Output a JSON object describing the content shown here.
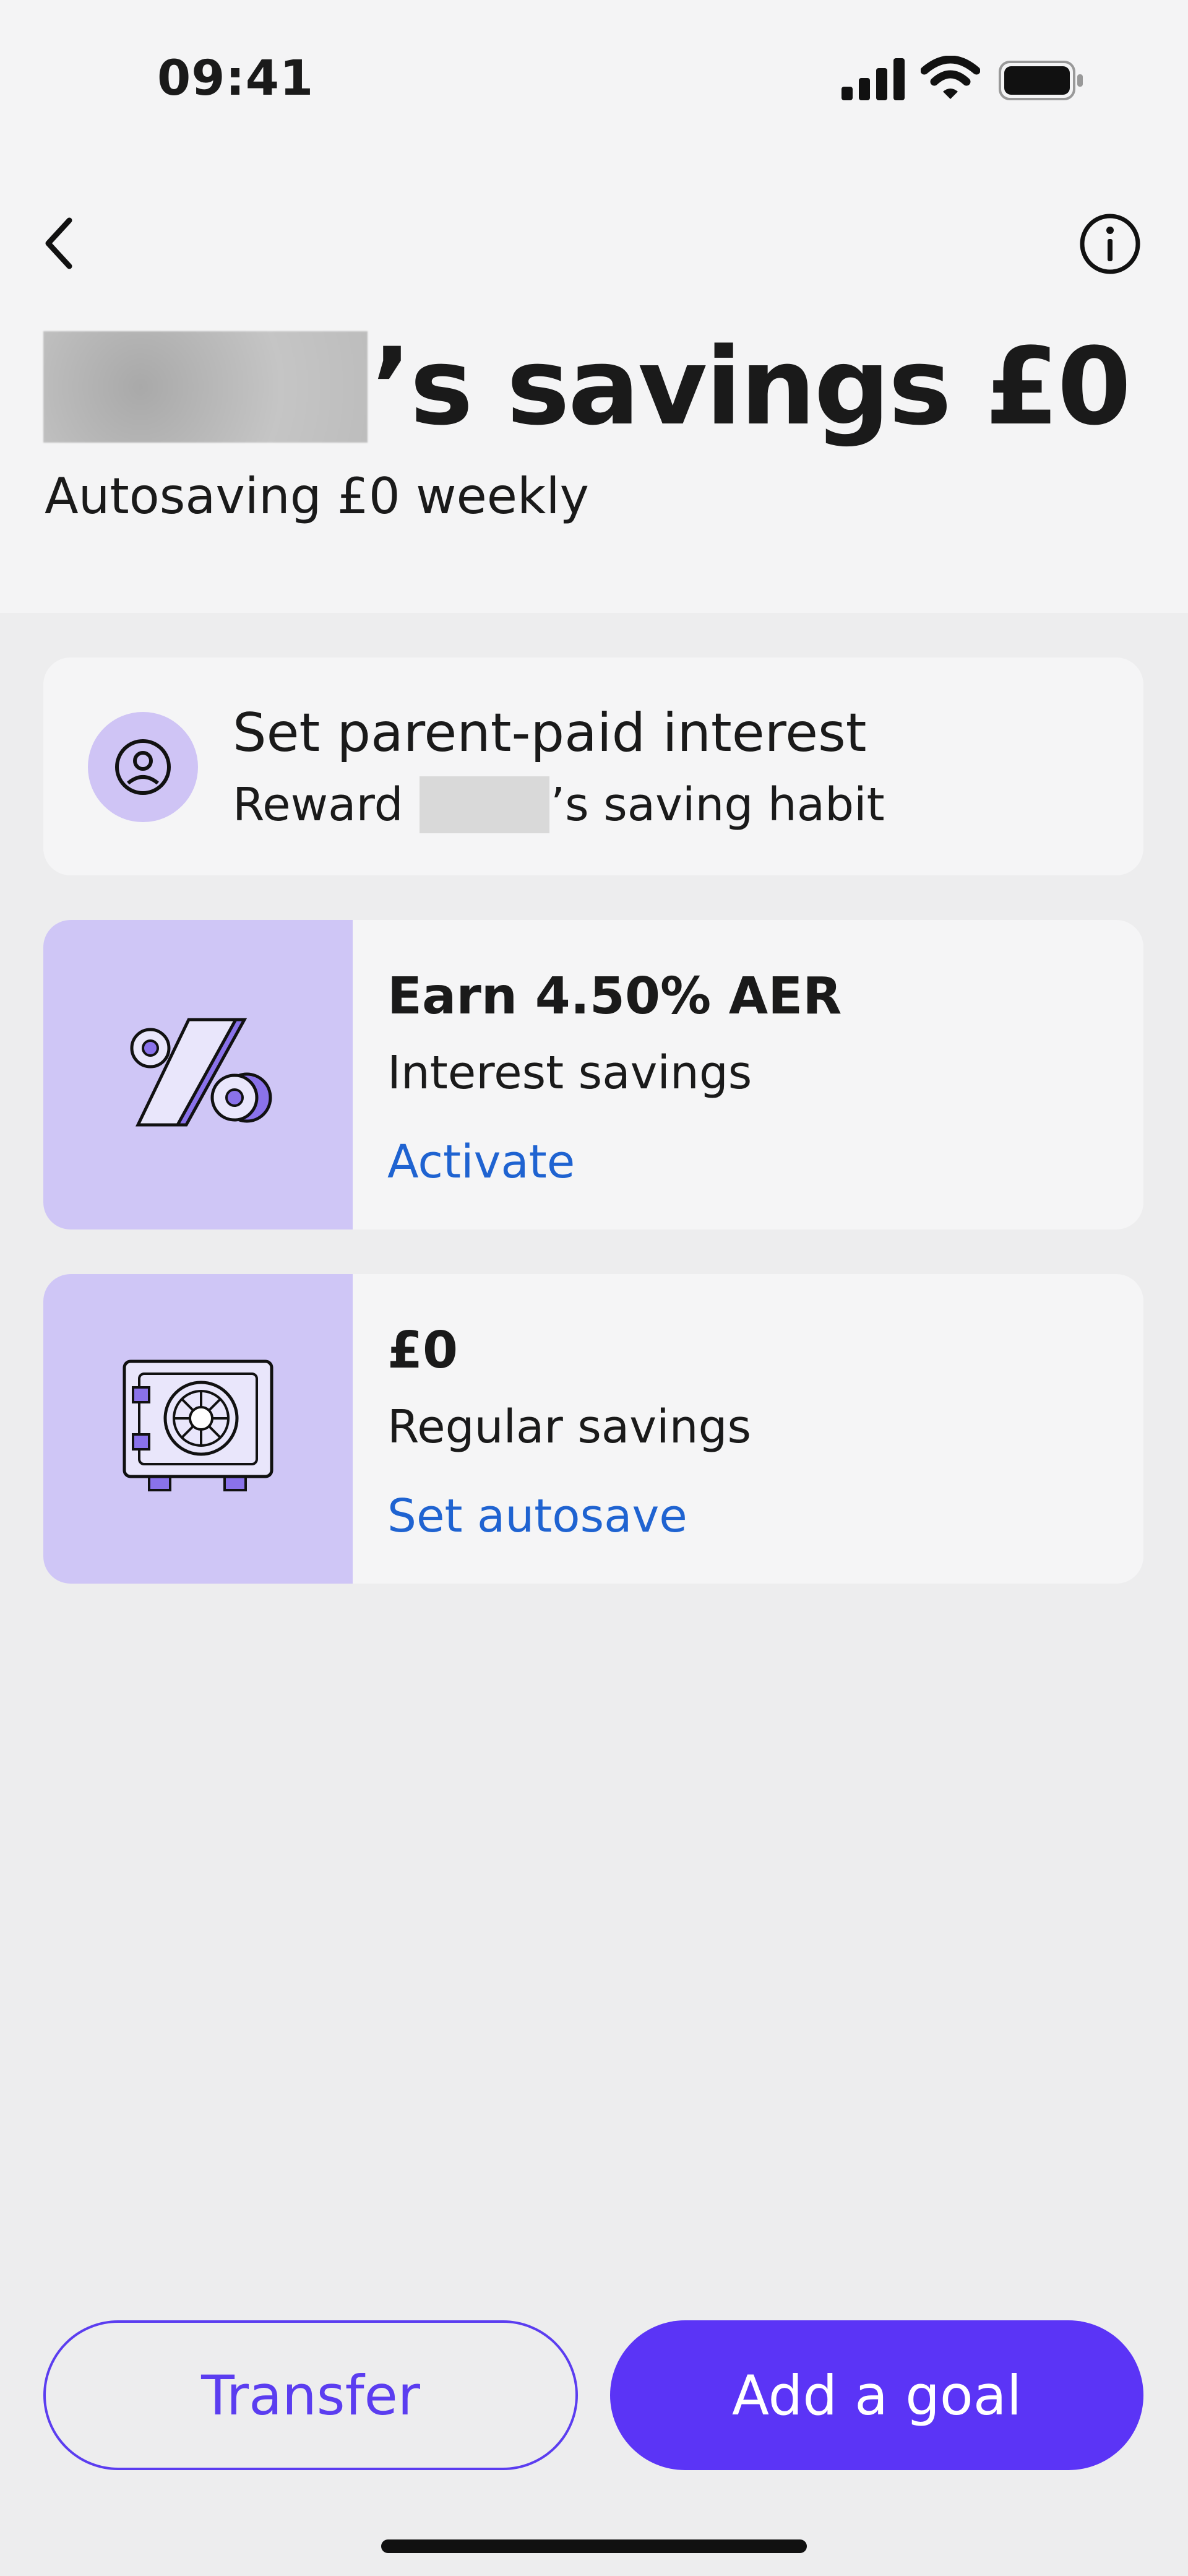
{
  "status_bar": {
    "time": "09:41",
    "icons": [
      "signal-icon",
      "wifi-icon",
      "battery-icon"
    ]
  },
  "header": {
    "back_icon": "chevron-left-icon",
    "info_icon": "info-icon",
    "title_suffix": "’s savings £0",
    "subtitle": "Autosaving £0 weekly"
  },
  "interest_card": {
    "icon": "person-icon",
    "title": "Set parent-paid interest",
    "subtitle_prefix": "Reward",
    "subtitle_suffix": "’s saving habit"
  },
  "aer_card": {
    "icon": "percent-icon",
    "title": "Earn 4.50% AER",
    "subtitle": "Interest savings",
    "link": "Activate"
  },
  "regular_card": {
    "icon": "safe-icon",
    "title": "£0",
    "subtitle": "Regular savings",
    "link": "Set autosave"
  },
  "actions": {
    "transfer_label": "Transfer",
    "add_goal_label": "Add a goal"
  },
  "colors": {
    "accent": "#5b34f6",
    "link": "#1f63d1",
    "panel": "#cfc6f6",
    "background": "#ededee"
  }
}
